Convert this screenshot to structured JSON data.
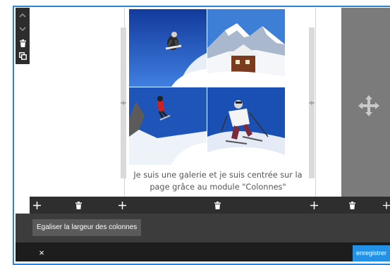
{
  "left_toolbar": {
    "icons": [
      "chevron-up-icon",
      "chevron-down-icon",
      "trash-icon",
      "duplicate-icon"
    ]
  },
  "gallery": {
    "images": [
      "snowboarder-jumping-photo",
      "mountain-chalet-photo",
      "skier-red-jacket-photo",
      "skier-white-jacket-photo"
    ],
    "caption": "Je suis une galerie et je suis centrée sur la page grâce au module \"Colonnes\""
  },
  "column_toolbar": {
    "icons": [
      "plus-icon",
      "trash-icon",
      "plus-icon",
      "trash-icon",
      "plus-icon",
      "trash-icon",
      "plus-icon"
    ]
  },
  "panel": {
    "equalize_label": "Egaliser la largeur des colonnes"
  },
  "footer": {
    "close_symbol": "×",
    "save_label": "enregistrer"
  },
  "colors": {
    "frame_border": "#2a83d8",
    "toolbar_bg": "#2e2e2e",
    "panel_bg": "#3c3c3c",
    "footer_bg": "#1d1d1d",
    "save_button": "#2392e6",
    "selected_column": "#7b7b7b"
  }
}
